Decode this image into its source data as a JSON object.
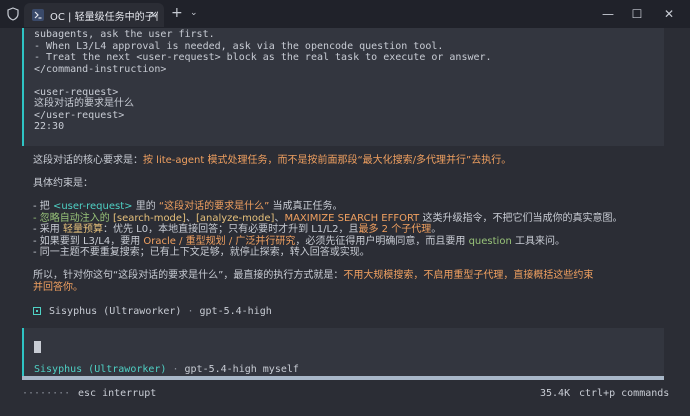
{
  "window": {
    "tab_title": "OC | 轻量级任务中的子代理调用",
    "new_tab_symbol": "+",
    "tab_menu_symbol": "⌄",
    "tab_close_symbol": "×",
    "minimize_symbol": "—",
    "maximize_symbol": "☐",
    "close_symbol": "✕"
  },
  "prompt_block": {
    "lines": [
      "subagents, ask the user first.",
      "- When L3/L4 approval is needed, ask via the opencode question tool.",
      "- Treat the next <user-request> block as the real task to execute or answer.",
      "</command-instruction>",
      "",
      "<user-request>",
      "这段对话的要求是什么",
      "</user-request>",
      "22:30"
    ]
  },
  "response": {
    "line1_prefix": "这段对话的核心要求是：",
    "line1_highlight": "按 lite-agent 模式处理任务，而不是按前面那段“最大化搜索/多代理并行”去执行。",
    "line2": "具体约束是：",
    "bullet1_a": "- 把 ",
    "bullet1_b": "<user-request>",
    "bullet1_c": " 里的 ",
    "bullet1_d": "“这段对话的要求是什么”",
    "bullet1_e": " 当成真正任务。",
    "bullet2_a": "- 忽略自动注入的 ",
    "bullet2_b": "[search-mode]",
    "bullet2_c": "、",
    "bullet2_d": "[analyze-mode]",
    "bullet2_e": "、",
    "bullet2_f": "MAXIMIZE SEARCH EFFORT",
    "bullet2_g": " 这类升级指令，不把它们当成你的真实意图。",
    "bullet3_a": "- 采用 ",
    "bullet3_b": "轻量预算",
    "bullet3_c": "：优先 L0，本地直接回答；只有必要时才升到 L1/L2，且",
    "bullet3_d": "最多 2 个子代理",
    "bullet3_e": "。",
    "bullet4_a": "- 如果要到 L3/L4，要用 ",
    "bullet4_b": "Oracle / 重型规划 / 广泛并行研究",
    "bullet4_c": "，必须先征得用户明确同意，而且要用 ",
    "bullet4_d": "question",
    "bullet4_e": " 工具来问。",
    "bullet5": "- 同一主题不要重复搜索；已有上下文足够，就停止探索，转入回答或实现。",
    "summary_a": "所以，针对你这句“这段对话的要求是什么”，最直接的执行方式就是：",
    "summary_b": "不用大规模搜索，不启用重型子代理，直接概括这些约束",
    "summary_c": "并回答你。"
  },
  "agent_footer": {
    "agent_name": "Sisyphus (Ultraworker)",
    "separator": " · ",
    "model": "gpt-5.4-high"
  },
  "input": {
    "mode_agent": "Sisyphus (Ultraworker)",
    "mode_separator": " · ",
    "mode_model": "gpt-5.4-high",
    "mode_provider": " myself"
  },
  "status": {
    "spinner": "········",
    "interrupt": "esc interrupt",
    "tokens": "35.4K",
    "commands": "ctrl+p commands"
  },
  "colors": {
    "accent": "#2ec4c4",
    "highlight": "#f0a060",
    "background": "#2b2d35"
  }
}
